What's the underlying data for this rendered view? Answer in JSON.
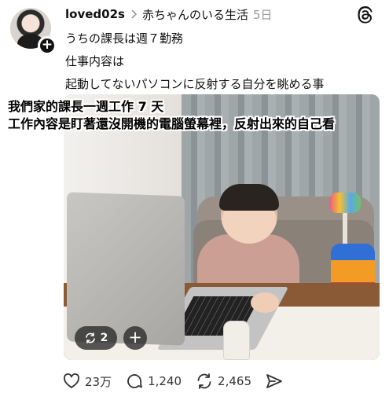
{
  "post": {
    "username": "loved02s",
    "topic": "赤ちゃんのいる生活",
    "time": "5日",
    "lines": [
      "うちの課長は週７勤務",
      "仕事内容は",
      "起動してないパソコンに反射する自分を眺める事"
    ]
  },
  "overlay_caption": {
    "line1": "我們家的課長一週工作 7 天",
    "line2": "工作內容是盯著還沒開機的電腦螢幕裡，反射出來的自己看"
  },
  "media_controls": {
    "repost_count": "2"
  },
  "actions": {
    "likes": "23万",
    "replies": "1,240",
    "reposts": "2,465"
  },
  "icons": {
    "avatar_plus": "+",
    "media_plus": "+",
    "topic_separator": "chevron-right-icon",
    "app": "threads-icon",
    "like": "heart-icon",
    "reply": "comment-icon",
    "repost": "repost-icon",
    "share": "send-icon"
  }
}
